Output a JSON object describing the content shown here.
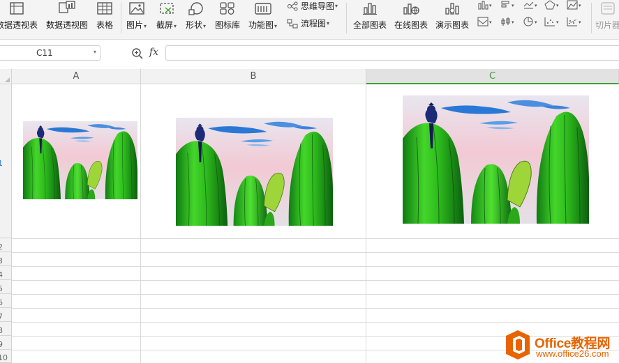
{
  "ribbon": {
    "pivot_table": "数据透视表",
    "pivot_chart": "数据透视图",
    "table": "表格",
    "picture": "图片",
    "screenshot": "截屏",
    "shapes": "形状",
    "icon_library": "图标库",
    "function_chart": "功能图",
    "mind_map": "思维导图",
    "flowchart": "流程图",
    "all_charts": "全部图表",
    "online_charts": "在线图表",
    "demo_charts": "演示图表",
    "slicer": "切片器"
  },
  "formula_bar": {
    "name_box": "C11",
    "fx_label": "fx",
    "formula": ""
  },
  "grid": {
    "columns": [
      "A",
      "B",
      "C"
    ],
    "selected_column": "C",
    "rows": [
      "1",
      "2",
      "3",
      "4",
      "5",
      "6",
      "7",
      "8",
      "9",
      "10"
    ]
  },
  "pictures": [
    {
      "subject": "cactus painting with bird",
      "cell": "A1"
    },
    {
      "subject": "cactus painting with bird",
      "cell": "B1"
    },
    {
      "subject": "cactus painting with bird",
      "cell": "C1"
    }
  ],
  "watermark": {
    "title": "Office教程网",
    "url": "www.office26.com"
  },
  "colors": {
    "accent_green": "#3f9c35",
    "watermark_orange": "#e86400",
    "cactus_green": "#2fbf1f",
    "sky_blue": "#2a78d6"
  }
}
